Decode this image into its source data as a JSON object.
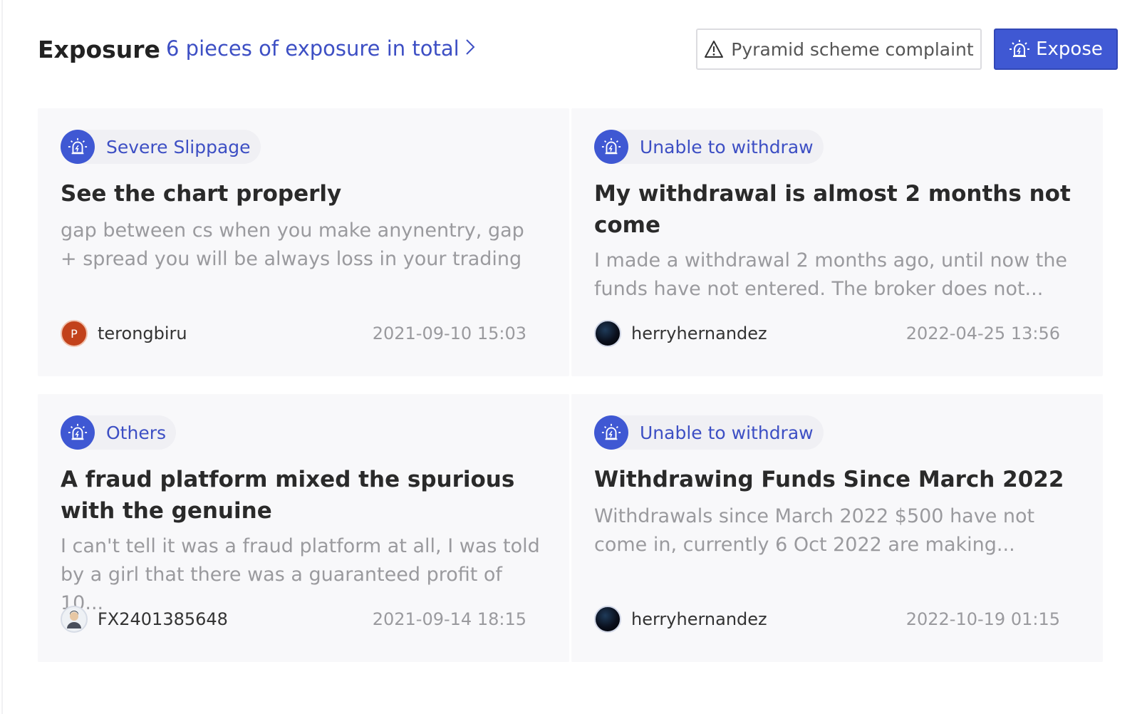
{
  "header": {
    "title": "Exposure",
    "total_link": "6 pieces of exposure in total",
    "complaint_label": "Pyramid scheme complaint",
    "expose_label": "Expose"
  },
  "colors": {
    "accent": "#3f58d3",
    "link": "#3d4fc4",
    "card_bg": "#f8f8fa",
    "muted_text": "#9a9a9e"
  },
  "cards": [
    {
      "tag": "Severe Slippage",
      "title": "See the chart properly",
      "excerpt": "gap between cs when you make anynentry, gap + spread you will be always loss in your trading",
      "author": "terongbiru",
      "avatar_letter": "P",
      "date": "2021-09-10 15:03"
    },
    {
      "tag": "Unable to withdraw",
      "title": "My withdrawal is almost 2 months not come",
      "excerpt": "I made a withdrawal 2 months ago, until now the funds have not entered. The broker does not...",
      "author": "herryhernandez",
      "date": "2022-04-25 13:56"
    },
    {
      "tag": "Others",
      "title": "A fraud platform mixed the spurious with the genuine",
      "excerpt": "I can't tell it was a fraud platform at all, I was told by a girl that there was a guaranteed profit of 10...",
      "author": "FX2401385648",
      "date": "2021-09-14 18:15"
    },
    {
      "tag": "Unable to withdraw",
      "title": "Withdrawing Funds Since March 2022",
      "excerpt": "Withdrawals since March 2022 $500 have not come in, currently 6 Oct 2022 are making...",
      "author": "herryhernandez",
      "date": "2022-10-19 01:15"
    }
  ]
}
